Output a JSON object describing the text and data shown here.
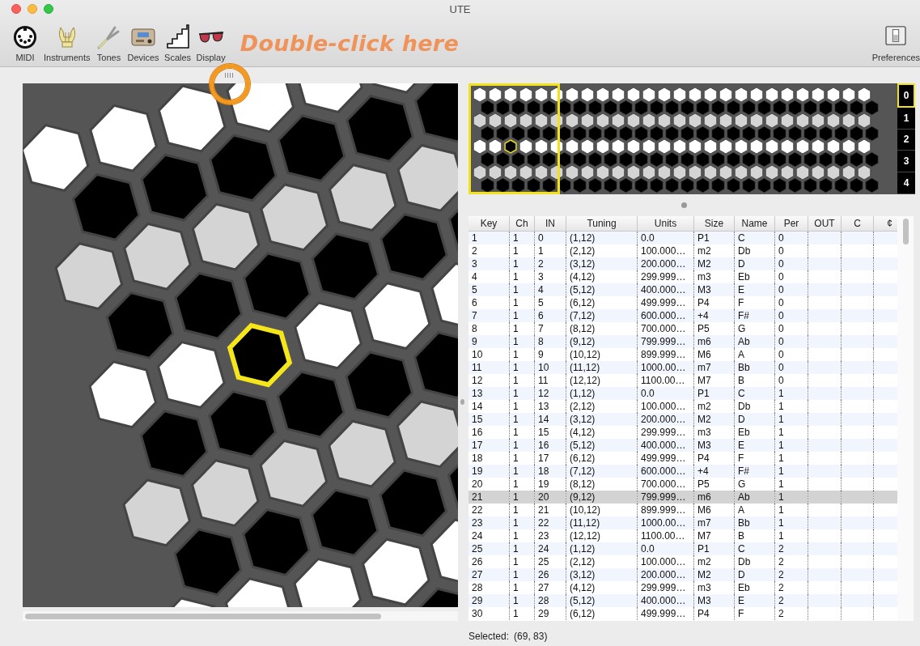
{
  "window": {
    "title": "UTE"
  },
  "toolbar": {
    "items": [
      {
        "label": "MIDI",
        "kind": "midi"
      },
      {
        "label": "Instruments",
        "kind": "lyre"
      },
      {
        "label": "Tones",
        "kind": "fork"
      },
      {
        "label": "Devices",
        "kind": "device"
      },
      {
        "label": "Scales",
        "kind": "stairs"
      },
      {
        "label": "Display",
        "kind": "glasses"
      }
    ],
    "annotation": "Double-click here",
    "preferences": {
      "label": "Preferences"
    }
  },
  "octaves": [
    {
      "label": "0",
      "selected": true
    },
    {
      "label": "1",
      "selected": false
    },
    {
      "label": "2",
      "selected": false
    },
    {
      "label": "3",
      "selected": false
    },
    {
      "label": "4",
      "selected": false
    }
  ],
  "table": {
    "columns": [
      "Key",
      "Ch",
      "IN",
      "Tuning",
      "Units",
      "Size",
      "Name",
      "Per",
      "OUT",
      "C",
      "¢"
    ],
    "rows": [
      {
        "cells": [
          "1",
          "1",
          "0",
          "(1,12)",
          "0.0",
          "P1",
          "C",
          "0"
        ],
        "selected": false
      },
      {
        "cells": [
          "2",
          "1",
          "1",
          "(2,12)",
          "100.000…",
          "m2",
          "Db",
          "0"
        ],
        "selected": false
      },
      {
        "cells": [
          "3",
          "1",
          "2",
          "(3,12)",
          "200.000…",
          "M2",
          "D",
          "0"
        ],
        "selected": false
      },
      {
        "cells": [
          "4",
          "1",
          "3",
          "(4,12)",
          "299.999…",
          "m3",
          "Eb",
          "0"
        ],
        "selected": false
      },
      {
        "cells": [
          "5",
          "1",
          "4",
          "(5,12)",
          "400.000…",
          "M3",
          "E",
          "0"
        ],
        "selected": false
      },
      {
        "cells": [
          "6",
          "1",
          "5",
          "(6,12)",
          "499.999…",
          "P4",
          "F",
          "0"
        ],
        "selected": false
      },
      {
        "cells": [
          "7",
          "1",
          "6",
          "(7,12)",
          "600.000…",
          "+4",
          "F#",
          "0"
        ],
        "selected": false
      },
      {
        "cells": [
          "8",
          "1",
          "7",
          "(8,12)",
          "700.000…",
          "P5",
          "G",
          "0"
        ],
        "selected": false
      },
      {
        "cells": [
          "9",
          "1",
          "8",
          "(9,12)",
          "799.999…",
          "m6",
          "Ab",
          "0"
        ],
        "selected": false
      },
      {
        "cells": [
          "10",
          "1",
          "9",
          "(10,12)",
          "899.999…",
          "M6",
          "A",
          "0"
        ],
        "selected": false
      },
      {
        "cells": [
          "11",
          "1",
          "10",
          "(11,12)",
          "1000.00…",
          "m7",
          "Bb",
          "0"
        ],
        "selected": false
      },
      {
        "cells": [
          "12",
          "1",
          "11",
          "(12,12)",
          "1100.00…",
          "M7",
          "B",
          "0"
        ],
        "selected": false
      },
      {
        "cells": [
          "13",
          "1",
          "12",
          "(1,12)",
          "0.0",
          "P1",
          "C",
          "1"
        ],
        "selected": false
      },
      {
        "cells": [
          "14",
          "1",
          "13",
          "(2,12)",
          "100.000…",
          "m2",
          "Db",
          "1"
        ],
        "selected": false
      },
      {
        "cells": [
          "15",
          "1",
          "14",
          "(3,12)",
          "200.000…",
          "M2",
          "D",
          "1"
        ],
        "selected": false
      },
      {
        "cells": [
          "16",
          "1",
          "15",
          "(4,12)",
          "299.999…",
          "m3",
          "Eb",
          "1"
        ],
        "selected": false
      },
      {
        "cells": [
          "17",
          "1",
          "16",
          "(5,12)",
          "400.000…",
          "M3",
          "E",
          "1"
        ],
        "selected": false
      },
      {
        "cells": [
          "18",
          "1",
          "17",
          "(6,12)",
          "499.999…",
          "P4",
          "F",
          "1"
        ],
        "selected": false
      },
      {
        "cells": [
          "19",
          "1",
          "18",
          "(7,12)",
          "600.000…",
          "+4",
          "F#",
          "1"
        ],
        "selected": false
      },
      {
        "cells": [
          "20",
          "1",
          "19",
          "(8,12)",
          "700.000…",
          "P5",
          "G",
          "1"
        ],
        "selected": false
      },
      {
        "cells": [
          "21",
          "1",
          "20",
          "(9,12)",
          "799.999…",
          "m6",
          "Ab",
          "1"
        ],
        "selected": true
      },
      {
        "cells": [
          "22",
          "1",
          "21",
          "(10,12)",
          "899.999…",
          "M6",
          "A",
          "1"
        ],
        "selected": false
      },
      {
        "cells": [
          "23",
          "1",
          "22",
          "(11,12)",
          "1000.00…",
          "m7",
          "Bb",
          "1"
        ],
        "selected": false
      },
      {
        "cells": [
          "24",
          "1",
          "23",
          "(12,12)",
          "1100.00…",
          "M7",
          "B",
          "1"
        ],
        "selected": false
      },
      {
        "cells": [
          "25",
          "1",
          "24",
          "(1,12)",
          "0.0",
          "P1",
          "C",
          "2"
        ],
        "selected": false
      },
      {
        "cells": [
          "26",
          "1",
          "25",
          "(2,12)",
          "100.000…",
          "m2",
          "Db",
          "2"
        ],
        "selected": false
      },
      {
        "cells": [
          "27",
          "1",
          "26",
          "(3,12)",
          "200.000…",
          "M2",
          "D",
          "2"
        ],
        "selected": false
      },
      {
        "cells": [
          "28",
          "1",
          "27",
          "(4,12)",
          "299.999…",
          "m3",
          "Eb",
          "2"
        ],
        "selected": false
      },
      {
        "cells": [
          "29",
          "1",
          "28",
          "(5,12)",
          "400.000…",
          "M3",
          "E",
          "2"
        ],
        "selected": false
      },
      {
        "cells": [
          "30",
          "1",
          "29",
          "(6,12)",
          "499.999…",
          "P4",
          "F",
          "2"
        ],
        "selected": false
      }
    ]
  },
  "status_bar": {
    "label": "Selected:",
    "value": "(69, 83)"
  }
}
